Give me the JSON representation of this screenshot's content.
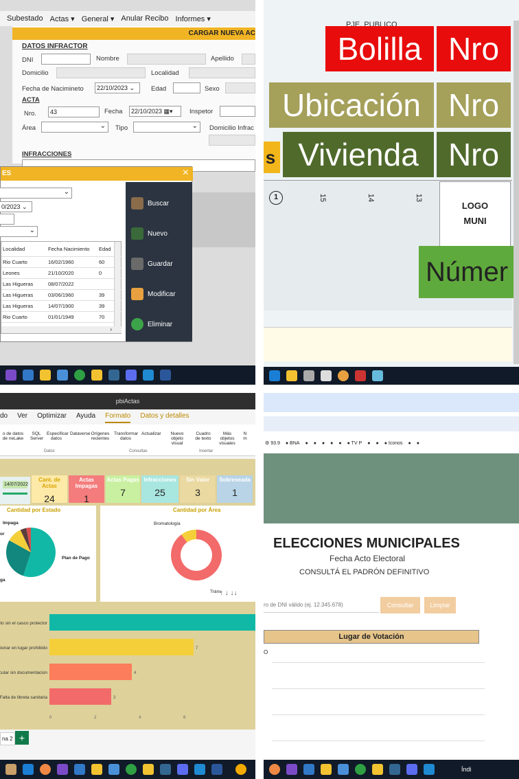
{
  "q1": {
    "menu": [
      "Subestado",
      "Actas",
      "General",
      "Anular Recibo",
      "Informes"
    ],
    "form_title": "CARGAR NUEVA AC",
    "datos_infractor": "DATOS INFRACTOR",
    "dni": "DNI",
    "nombre": "Nombre",
    "apellido": "Apellido",
    "domicilio": "Domicilio",
    "localidad": "Localidad",
    "fecha_nac": "Fecha de Nacimineto",
    "fecha_nac_val": "22/10/2023",
    "edad": "Edad",
    "sexo": "Sexo",
    "acta": "ACTA",
    "nro": "Nro.",
    "nro_val": "43",
    "fecha": "Fecha",
    "fecha_val": "22/10/2023",
    "inspector": "Inspetor",
    "area": "Área",
    "tipo": "Tipo",
    "domicilio_infrac": "Domicilio Infrac",
    "infracciones": "INFRACCIONES",
    "popup_title": "ES",
    "popup_date": "0/2023",
    "col_localidad": "Localidad",
    "col_fecha": "Fecha Nacimiento",
    "col_edad": "Edad",
    "rows": [
      [
        "Rio Cuarto",
        "16/02/1960",
        "60"
      ],
      [
        "Leones",
        "21/10/2020",
        "0"
      ],
      [
        "Las Higueras",
        "08/07/2022",
        ""
      ],
      [
        "Las Higueras",
        "03/06/1960",
        "39"
      ],
      [
        "Las Higueras",
        "14/07/1900",
        "39"
      ],
      [
        "Rio Cuarto",
        "01/01/1949",
        "70"
      ]
    ],
    "buttons": [
      "Buscar",
      "Nuevo",
      "Guardar",
      "Modificar",
      "Eliminar"
    ]
  },
  "q2": {
    "street": "PJE. PUBLICO",
    "bolilla": "Bolilla",
    "nro": "Nro",
    "ubicacion": "Ubicación",
    "vivienda": "Vivienda",
    "s": "s",
    "logo": "LOGO MUNI",
    "numero": "Númer",
    "nums": [
      "1",
      "15",
      "14",
      "13"
    ]
  },
  "q3": {
    "app_title": "pbiActas",
    "ribbon_tabs": [
      "do",
      "Ver",
      "Optimizar",
      "Ayuda",
      "Formato",
      "Datos y detalles"
    ],
    "ribbon_items": [
      "o de datos de neLake",
      "SQL Server",
      "Especificar datos",
      "Dataverse",
      "Orígenes recientes",
      "Transformar datos",
      "Actualizar",
      "Nuevo objeto visual",
      "Cuadro de texto",
      "Más objetos visuales",
      "N m"
    ],
    "group_datos": "Datos",
    "group_consultas": "Consultas",
    "group_insertar": "Insertar",
    "date": "14/07/2022",
    "kpis": [
      {
        "label": "Cant. de Actas",
        "value": "24",
        "color": "#fde9a8",
        "hc": "#d9a400"
      },
      {
        "label": "Actas Impagas",
        "value": "1",
        "color": "#f47c7c",
        "hc": "#ffffff"
      },
      {
        "label": "Actas Pagas",
        "value": "7",
        "color": "#c9f0a0",
        "hc": "#ffffff"
      },
      {
        "label": "Infracciones",
        "value": "25",
        "color": "#a8e6e0",
        "hc": "#ffffff"
      },
      {
        "label": "Sin Valor",
        "value": "3",
        "color": "#ead9a0",
        "hc": "#ffffff"
      },
      {
        "label": "Sobreseada",
        "value": "1",
        "color": "#b8d4e6",
        "hc": "#ffffff"
      }
    ],
    "chart1_title": "Cantidad por Estado",
    "chart2_title": "Cantidad por Área",
    "pie_labels": [
      "Impaga",
      "or",
      "Plan de Pago",
      "ga"
    ],
    "donut_labels": [
      "Bromatología",
      "Tráns"
    ],
    "bars": [
      {
        "label": "to sin el casco protector",
        "value": 10,
        "color": "#12b8a6"
      },
      {
        "label": "cionar en lugar prohibido",
        "value": 7,
        "color": "#f4cf3a"
      },
      {
        "label": "cular sin documentacion",
        "value": 4,
        "color": "#fb7d5b"
      },
      {
        "label": "Falta de libreta sanitaria",
        "value": 3,
        "color": "#f36a6a"
      }
    ],
    "bar_val_labels": [
      "",
      "7",
      "4",
      "3"
    ],
    "axis_ticks": [
      "0",
      "2",
      "4",
      "6"
    ],
    "page_tab": "na 2",
    "add_page": "+"
  },
  "q4": {
    "bookmarks": [
      "93.9",
      "BNA",
      "TV P",
      "Iconos"
    ],
    "title": "ELECCIONES MUNICIPALES",
    "subtitle": "Fecha Acto Electoral",
    "sub2": "CONSULTÁ EL PADRÓN DEFINITIVO",
    "placeholder": "ro de DNI válido (ej. 12.345.678)",
    "consultar": "Consultar",
    "limpiar": "Limpiar",
    "lugar": "Lugar de Votación",
    "o": "O",
    "taskbar_text": "Índi"
  }
}
